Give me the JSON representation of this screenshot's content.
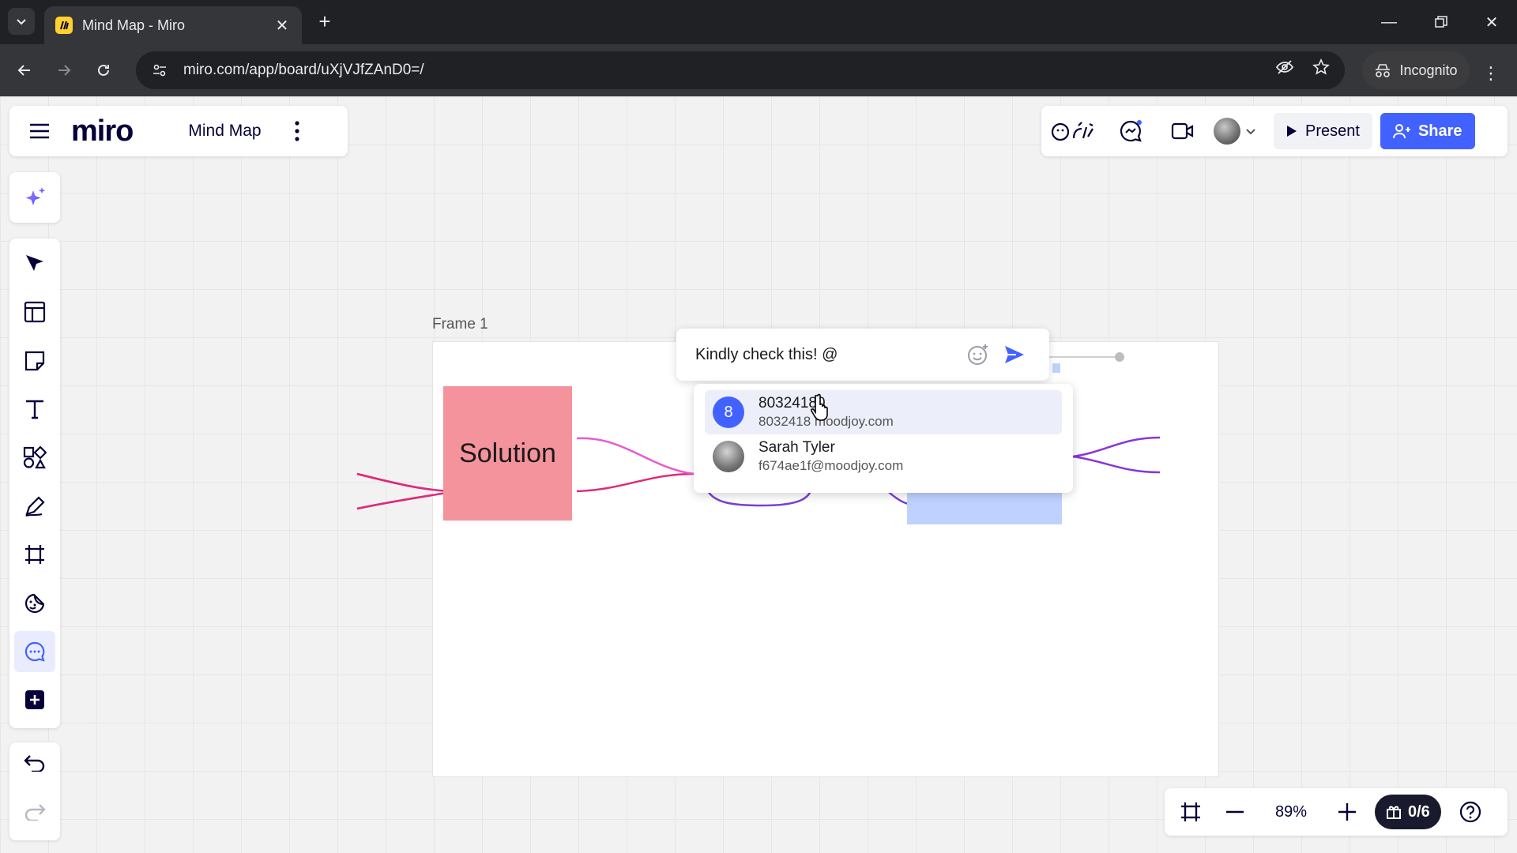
{
  "browser": {
    "tab_title": "Mind Map - Miro",
    "url": "miro.com/app/board/uXjVJfZAnD0=/",
    "incognito_label": "Incognito"
  },
  "app": {
    "logo": "miro",
    "board_name": "Mind Map",
    "present_label": "Present",
    "share_label": "Share",
    "zoom_level": "89%",
    "counter": "0/6",
    "brand_color": "#4262ff"
  },
  "canvas": {
    "frame_label": "Frame 1",
    "sticky_text": "Solution",
    "sticky_color": "#f4939c",
    "node_color": "#bfd2ff"
  },
  "comment": {
    "text": "Kindly check this! @",
    "mentions": [
      {
        "avatar": "8",
        "name": "80324180",
        "email": "8032418 moodjoy.com"
      },
      {
        "avatar": "",
        "name": "Sarah Tyler",
        "email": "f674ae1f@moodjoy.com"
      }
    ]
  },
  "icons": {
    "tools": [
      "select-icon",
      "templates-icon",
      "sticky-note-icon",
      "text-icon",
      "shapes-icon",
      "pen-icon",
      "frame-icon",
      "stickers-icon",
      "comment-icon",
      "more-apps-icon"
    ]
  }
}
